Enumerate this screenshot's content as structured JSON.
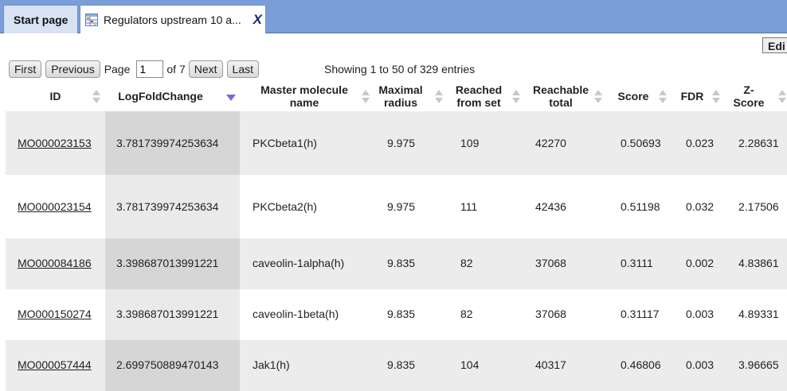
{
  "tabs": {
    "start_label": "Start page",
    "active_label": "Regulators upstream 10 a...",
    "close_label": "X"
  },
  "toolbar": {
    "edit_label": "Edi"
  },
  "pager": {
    "first": "First",
    "previous": "Previous",
    "page_label": "Page",
    "page_value": "1",
    "of_label": "of 7",
    "next": "Next",
    "last": "Last"
  },
  "showing": "Showing 1 to 50 of 329 entries",
  "columns": {
    "id": "ID",
    "logfc": "LogFoldChange",
    "master_1": "Master molecule",
    "master_2": "name",
    "radius_1": "Maximal",
    "radius_2": "radius",
    "reached_1": "Reached",
    "reached_2": "from set",
    "reachable_1": "Reachable",
    "reachable_2": "total",
    "score": "Score",
    "fdr": "FDR",
    "z_1": "Z-",
    "z_2": "Score"
  },
  "rows": [
    {
      "id": "MO000023153",
      "logfc": "3.781739974253634",
      "name": "PKCbeta1(h)",
      "radius": "9.975",
      "reached": "109",
      "reachable": "42270",
      "score": "0.50693",
      "fdr": "0.023",
      "z": "2.28631"
    },
    {
      "id": "MO000023154",
      "logfc": "3.781739974253634",
      "name": "PKCbeta2(h)",
      "radius": "9.975",
      "reached": "111",
      "reachable": "42436",
      "score": "0.51198",
      "fdr": "0.032",
      "z": "2.17506"
    },
    {
      "id": "MO000084186",
      "logfc": "3.398687013991221",
      "name": "caveolin-1alpha(h)",
      "radius": "9.835",
      "reached": "82",
      "reachable": "37068",
      "score": "0.3111",
      "fdr": "0.002",
      "z": "4.83861"
    },
    {
      "id": "MO000150274",
      "logfc": "3.398687013991221",
      "name": "caveolin-1beta(h)",
      "radius": "9.835",
      "reached": "82",
      "reachable": "37068",
      "score": "0.31117",
      "fdr": "0.003",
      "z": "4.89331"
    },
    {
      "id": "MO000057444",
      "logfc": "2.699750889470143",
      "name": "Jak1(h)",
      "radius": "9.835",
      "reached": "104",
      "reachable": "40317",
      "score": "0.46806",
      "fdr": "0.003",
      "z": "3.96665"
    }
  ]
}
